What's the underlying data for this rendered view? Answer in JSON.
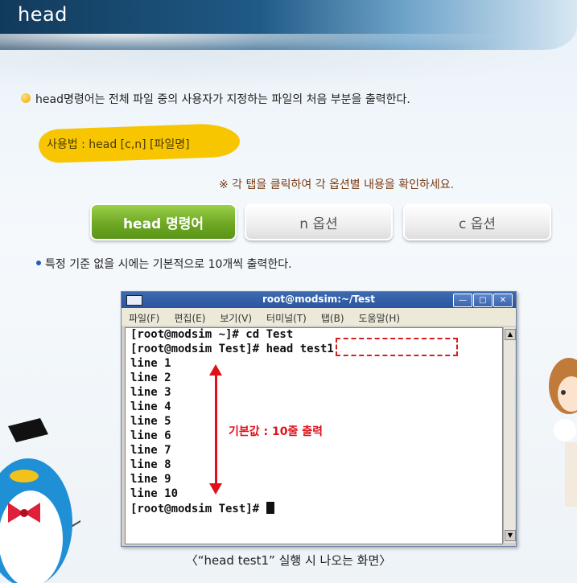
{
  "banner": {
    "title": "head"
  },
  "intro": {
    "text": "head명령어는 전체 파일 중의 사용자가 지정하는 파일의 처음 부분을 출력한다."
  },
  "usage": {
    "text": "사용법 : head [c,n] [파일명]"
  },
  "notice": {
    "text": "※ 각 탭을 클릭하여 각 옵션별 내용을 확인하세요."
  },
  "tabs": [
    {
      "label": "head 명령어",
      "active": true
    },
    {
      "label": "n 옵션",
      "active": false
    },
    {
      "label": "c 옵션",
      "active": false
    }
  ],
  "subnote": {
    "text": "특정 기준 없을 시에는 기본적으로 10개씩 출력한다."
  },
  "terminal": {
    "title": "root@modsim:~/Test",
    "menu": [
      "파일(F)",
      "편집(E)",
      "보기(V)",
      "터미널(T)",
      "탭(B)",
      "도움말(H)"
    ],
    "lines": [
      "[root@modsim ~]# cd Test",
      "[root@modsim Test]# head test1",
      "line 1",
      "line 2",
      "line 3",
      "line 4",
      "line 5",
      "line 6",
      "line 7",
      "line 8",
      "line 9",
      "line 10",
      "[root@modsim Test]# "
    ],
    "annotation": "기본값 : 10줄 출력"
  },
  "caption": "〈“head test1” 실행 시 나오는 화면〉",
  "colors": {
    "accent_green": "#6ea824",
    "highlight_red": "#e0101a",
    "usage_yellow": "#f7c600"
  }
}
